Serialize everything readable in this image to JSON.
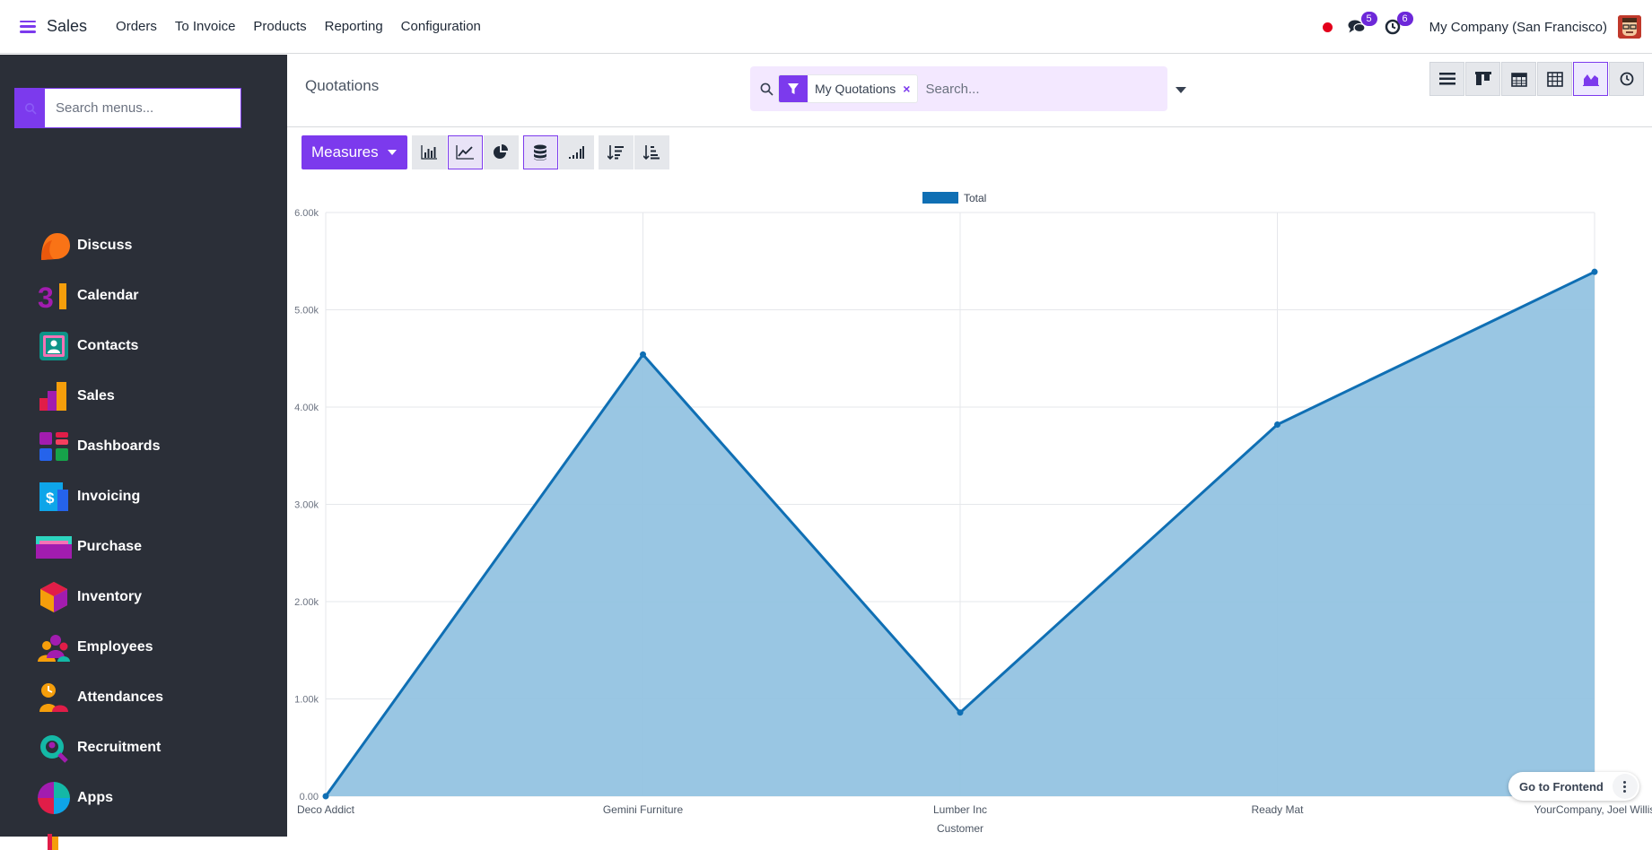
{
  "navbar": {
    "app_name": "Sales",
    "menu": [
      "Orders",
      "To Invoice",
      "Products",
      "Reporting",
      "Configuration"
    ],
    "messages_badge": "5",
    "activities_badge": "6",
    "company": "My Company (San Francisco)"
  },
  "sidebar": {
    "search_placeholder": "Search menus...",
    "apps": [
      {
        "label": "Discuss",
        "icon": "discuss-icon"
      },
      {
        "label": "Calendar",
        "icon": "calendar-icon"
      },
      {
        "label": "Contacts",
        "icon": "contacts-icon"
      },
      {
        "label": "Sales",
        "icon": "sales-icon"
      },
      {
        "label": "Dashboards",
        "icon": "dashboards-icon"
      },
      {
        "label": "Invoicing",
        "icon": "invoicing-icon"
      },
      {
        "label": "Purchase",
        "icon": "purchase-icon"
      },
      {
        "label": "Inventory",
        "icon": "inventory-icon"
      },
      {
        "label": "Employees",
        "icon": "employees-icon"
      },
      {
        "label": "Attendances",
        "icon": "attendances-icon"
      },
      {
        "label": "Recruitment",
        "icon": "recruitment-icon"
      },
      {
        "label": "Apps",
        "icon": "apps-icon"
      }
    ]
  },
  "control_panel": {
    "breadcrumb": "Quotations",
    "facet_label": "My Quotations",
    "search_placeholder": "Search...",
    "measures_label": "Measures"
  },
  "floating": {
    "go_frontend": "Go to Frontend"
  },
  "colors": {
    "accent": "#7c3aed",
    "series_line": "#0f6fb4",
    "series_fill": "#93c3e1"
  },
  "chart_data": {
    "type": "area",
    "categories": [
      "Deco Addict",
      "Gemini Furniture",
      "Lumber Inc",
      "Ready Mat",
      "YourCompany, Joel Willis"
    ],
    "series": [
      {
        "name": "Total",
        "values": [
          0,
          4540,
          860,
          3820,
          5390
        ]
      }
    ],
    "xlabel": "Customer",
    "ylabel": "",
    "ylim": [
      0,
      6000
    ],
    "yticks": [
      "0.00",
      "1.00k",
      "2.00k",
      "3.00k",
      "4.00k",
      "5.00k",
      "6.00k"
    ],
    "grid": true,
    "legend": "top-center"
  }
}
